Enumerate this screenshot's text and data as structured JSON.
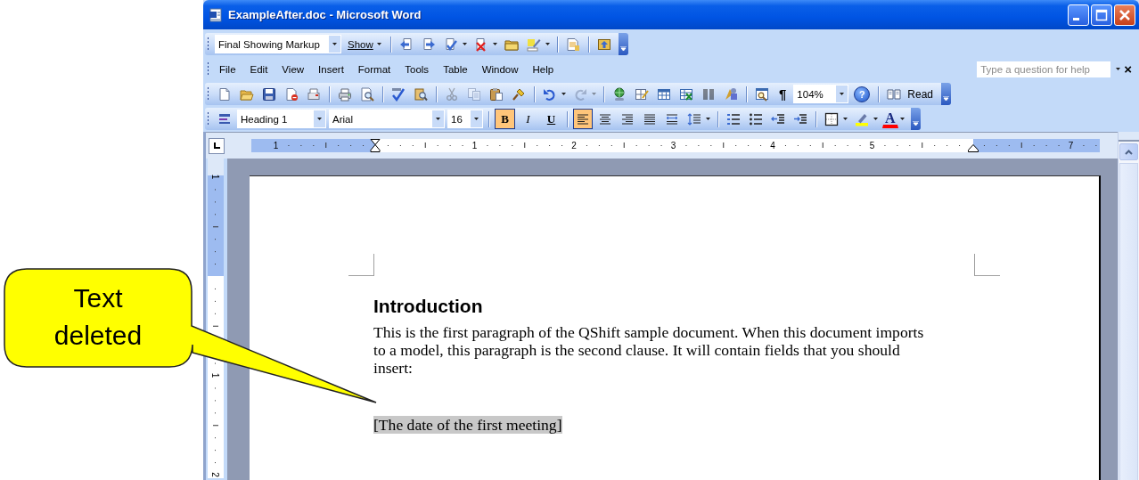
{
  "window": {
    "title": "ExampleAfter.doc - Microsoft Word"
  },
  "reviewing_toolbar": {
    "display": "Final Showing Markup",
    "show": "Show",
    "groups": [
      [
        {
          "kind": "previous"
        },
        {
          "kind": "next"
        },
        {
          "kind": "accept",
          "split": true
        },
        {
          "kind": "reject",
          "split": true
        },
        {
          "kind": "comment"
        },
        {
          "kind": "track",
          "split": true
        }
      ],
      [
        {
          "kind": "pane"
        }
      ],
      [
        {
          "kind": "upload"
        }
      ]
    ]
  },
  "menu": [
    {
      "label": "File"
    },
    {
      "label": "Edit"
    },
    {
      "label": "View"
    },
    {
      "label": "Insert"
    },
    {
      "label": "Format"
    },
    {
      "label": "Tools"
    },
    {
      "label": "Table"
    },
    {
      "label": "Window"
    },
    {
      "label": "Help"
    }
  ],
  "help_box": {
    "placeholder": "Type a question for help",
    "close": "×"
  },
  "standard_toolbar": {
    "groups": [
      [
        {
          "kind": "new",
          "disabled": false
        },
        {
          "kind": "open",
          "disabled": false
        },
        {
          "kind": "save",
          "disabled": false
        },
        {
          "kind": "permission",
          "disabled": false
        },
        {
          "kind": "email",
          "disabled": false
        }
      ],
      [
        {
          "kind": "print",
          "disabled": false
        },
        {
          "kind": "preview",
          "disabled": false
        }
      ],
      [
        {
          "kind": "spelling",
          "disabled": false
        },
        {
          "kind": "research",
          "disabled": false
        }
      ],
      [
        {
          "kind": "cut",
          "disabled": true
        },
        {
          "kind": "copy",
          "disabled": true
        },
        {
          "kind": "paste",
          "disabled": false
        },
        {
          "kind": "painter",
          "disabled": false
        }
      ],
      [
        {
          "kind": "undo",
          "disabled": false,
          "split": true
        },
        {
          "kind": "redo",
          "disabled": true,
          "split": true
        }
      ],
      [
        {
          "kind": "hyperlink",
          "disabled": false
        },
        {
          "kind": "tablesborders",
          "disabled": false
        },
        {
          "kind": "table",
          "disabled": false
        },
        {
          "kind": "excel",
          "disabled": false
        },
        {
          "kind": "columns",
          "disabled": false
        },
        {
          "kind": "drawing",
          "disabled": false
        }
      ],
      [
        {
          "kind": "docmap",
          "disabled": false
        }
      ]
    ],
    "pilcrow": "¶",
    "zoom": "104%",
    "help": "?",
    "read": "Read"
  },
  "formatting_toolbar": {
    "style": "Heading 1",
    "font": "Arial",
    "size": "16",
    "emphasis": [
      {
        "kind": "bold",
        "label": "B",
        "on": true
      },
      {
        "kind": "italic",
        "label": "I",
        "on": false
      },
      {
        "kind": "underline",
        "label": "U",
        "on": false
      }
    ],
    "alignment": [
      {
        "kind": "left",
        "selected": true
      },
      {
        "kind": "center",
        "selected": false
      },
      {
        "kind": "right",
        "selected": false
      },
      {
        "kind": "justify",
        "selected": false
      },
      {
        "kind": "distributed",
        "selected": false
      }
    ],
    "font_color": "A"
  },
  "ruler": {
    "numbers": [
      "1",
      "1",
      "2",
      "3",
      "4",
      "5",
      "7"
    ]
  },
  "vertical_ruler": {
    "numbers": [
      "1",
      "1",
      "2"
    ]
  },
  "document": {
    "heading": "Introduction",
    "paragraph": "This is the first paragraph of the QShift sample document. When this document imports to a model, this paragraph is the second clause. It will contain fields that you should insert:",
    "field": "[The date of the first meeting]"
  },
  "callout": {
    "text": "Text deleted"
  }
}
